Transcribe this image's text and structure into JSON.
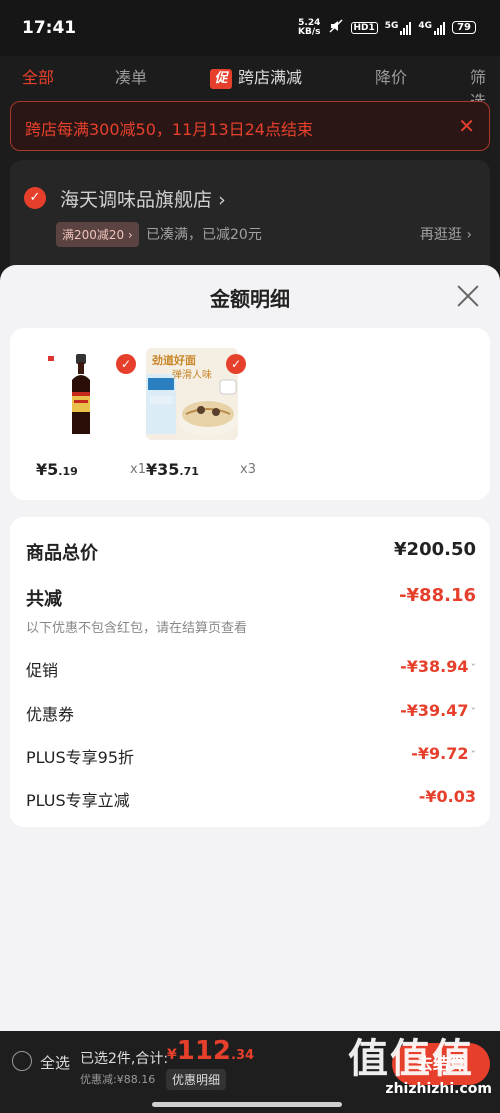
{
  "status_bar": {
    "time": "17:41",
    "net_speed_value": "5.24",
    "net_speed_unit": "KB/s",
    "hd_label": "HD1",
    "net_5g": "5G",
    "net_4g": "4G",
    "battery": "79"
  },
  "tabs": [
    {
      "label": "全部",
      "active": true
    },
    {
      "label": "凑单"
    },
    {
      "label": "跨店满减",
      "icon_text": "促"
    },
    {
      "label": "降价"
    },
    {
      "label": "筛选"
    }
  ],
  "banner": {
    "text": "跨店每满300减50，11月13日24点结束"
  },
  "store": {
    "name": "海天调味品旗舰店",
    "name_arrow": "›",
    "badge": "满200减20 ›",
    "status": "已凑满，已减20元",
    "more": "再逛逛 ›"
  },
  "sheet": {
    "title": "金额明细",
    "products": [
      {
        "name": "soy-sauce",
        "price_int": "¥5",
        "price_dec": ".19",
        "qty": "x1"
      },
      {
        "name": "noodles",
        "price_int": "¥35",
        "price_dec": ".71",
        "qty": "x3",
        "img_text_top": "劲道好面",
        "img_text_sub": "弹滑人味"
      }
    ],
    "summary": {
      "total_label": "商品总价",
      "total_value": "¥200.50",
      "reduce_label": "共减",
      "reduce_value": "-¥88.16",
      "hint": "以下优惠不包含红包，请在结算页查看",
      "items": [
        {
          "label": "促销",
          "value": "-¥38.94",
          "chevron": "ˇ"
        },
        {
          "label": "优惠券",
          "value": "-¥39.47",
          "chevron": "ˇ"
        },
        {
          "label": "PLUS专享95折",
          "value": "-¥9.72",
          "chevron": "ˇ"
        },
        {
          "label": "PLUS专享立减",
          "value": "-¥0.03"
        }
      ]
    }
  },
  "bottom_bar": {
    "select_all": "全选",
    "selected": "已选2件,合计:",
    "total_symbol": "¥",
    "total_int": "112",
    "total_dec": ".34",
    "discount": "优惠减:¥88.16",
    "detail_button": "优惠明细",
    "checkout": "去结算"
  },
  "watermark": {
    "big": "值值值",
    "url": "zhizhizhi.com"
  },
  "colors": {
    "accent": "#e6402c",
    "overlay": "#1c1c1c",
    "sheet_bg": "#f3f3f5"
  }
}
